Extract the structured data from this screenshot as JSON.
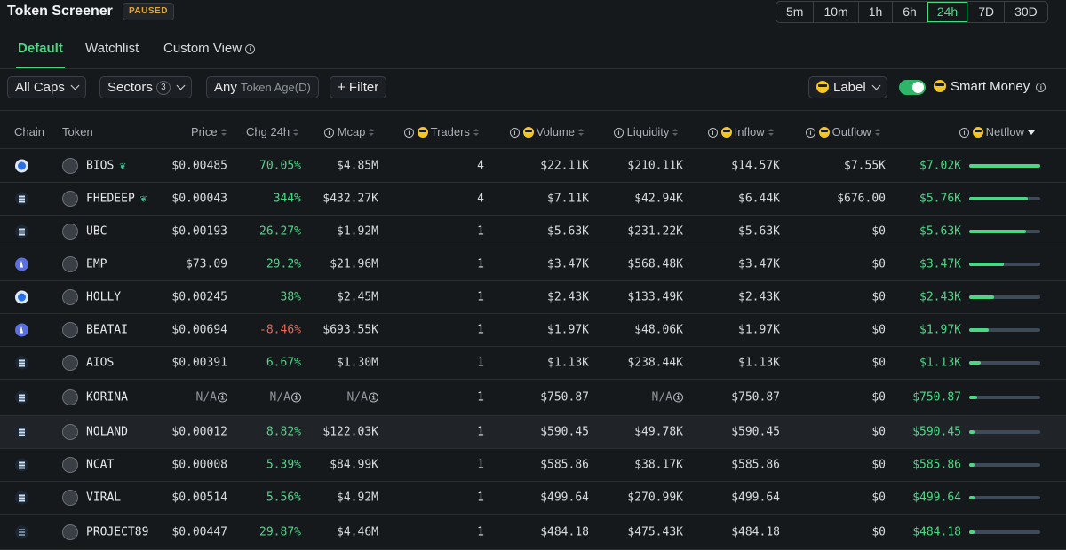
{
  "header": {
    "title": "Token Screener",
    "status": "PAUSED"
  },
  "timeframes": [
    {
      "label": "5m",
      "active": false
    },
    {
      "label": "10m",
      "active": false
    },
    {
      "label": "1h",
      "active": false
    },
    {
      "label": "6h",
      "active": false
    },
    {
      "label": "24h",
      "active": true
    },
    {
      "label": "7D",
      "active": false
    },
    {
      "label": "30D",
      "active": false
    }
  ],
  "tabs": {
    "default": "Default",
    "watchlist": "Watchlist",
    "custom": "Custom View"
  },
  "filters": {
    "caps": "All Caps",
    "sectors": "Sectors",
    "sectors_count": "3",
    "token_age_value": "Any",
    "token_age_label": "Token Age(D)",
    "filter": "+ Filter",
    "label": "Label",
    "smart_money": "Smart Money",
    "smart_money_on": true
  },
  "columns": {
    "chain": "Chain",
    "token": "Token",
    "price": "Price",
    "chg": "Chg 24h",
    "mcap": "Mcap",
    "traders": "Traders",
    "volume": "Volume",
    "liquidity": "Liquidity",
    "inflow": "Inflow",
    "outflow": "Outflow",
    "netflow": "Netflow"
  },
  "rows": [
    {
      "chain": "base",
      "token": "BIOS",
      "leaf": true,
      "price": "$0.00485",
      "chg": "70.05%",
      "chg_dir": "pos",
      "mcap": "$4.85M",
      "traders": "4",
      "volume": "$22.11K",
      "liquidity": "$210.11K",
      "inflow": "$14.57K",
      "outflow": "$7.55K",
      "netflow": "$7.02K",
      "netflow_fraction": 1.0
    },
    {
      "chain": "sol",
      "token": "FHEDEEP",
      "leaf": true,
      "price": "$0.00043",
      "chg": "344%",
      "chg_dir": "pos",
      "mcap": "$432.27K",
      "traders": "4",
      "volume": "$7.11K",
      "liquidity": "$42.94K",
      "inflow": "$6.44K",
      "outflow": "$676.00",
      "netflow": "$5.76K",
      "netflow_fraction": 0.82
    },
    {
      "chain": "sol",
      "token": "UBC",
      "leaf": false,
      "price": "$0.00193",
      "chg": "26.27%",
      "chg_dir": "pos",
      "mcap": "$1.92M",
      "traders": "1",
      "volume": "$5.63K",
      "liquidity": "$231.22K",
      "inflow": "$5.63K",
      "outflow": "$0",
      "netflow": "$5.63K",
      "netflow_fraction": 0.8
    },
    {
      "chain": "eth",
      "token": "EMP",
      "leaf": false,
      "price": "$73.09",
      "chg": "29.2%",
      "chg_dir": "pos",
      "mcap": "$21.96M",
      "traders": "1",
      "volume": "$3.47K",
      "liquidity": "$568.48K",
      "inflow": "$3.47K",
      "outflow": "$0",
      "netflow": "$3.47K",
      "netflow_fraction": 0.49
    },
    {
      "chain": "base",
      "token": "HOLLY",
      "leaf": false,
      "price": "$0.00245",
      "chg": "38%",
      "chg_dir": "pos",
      "mcap": "$2.45M",
      "traders": "1",
      "volume": "$2.43K",
      "liquidity": "$133.49K",
      "inflow": "$2.43K",
      "outflow": "$0",
      "netflow": "$2.43K",
      "netflow_fraction": 0.35
    },
    {
      "chain": "eth",
      "token": "BEATAI",
      "leaf": false,
      "price": "$0.00694",
      "chg": "-8.46%",
      "chg_dir": "neg",
      "mcap": "$693.55K",
      "traders": "1",
      "volume": "$1.97K",
      "liquidity": "$48.06K",
      "inflow": "$1.97K",
      "outflow": "$0",
      "netflow": "$1.97K",
      "netflow_fraction": 0.28
    },
    {
      "chain": "sol",
      "token": "AIOS",
      "leaf": false,
      "price": "$0.00391",
      "chg": "6.67%",
      "chg_dir": "pos",
      "mcap": "$1.30M",
      "traders": "1",
      "volume": "$1.13K",
      "liquidity": "$238.44K",
      "inflow": "$1.13K",
      "outflow": "$0",
      "netflow": "$1.13K",
      "netflow_fraction": 0.16
    },
    {
      "chain": "sol",
      "token": "KORINA",
      "leaf": false,
      "price": "N/A",
      "chg": "N/A",
      "chg_dir": "na",
      "mcap": "N/A",
      "traders": "1",
      "volume": "$750.87",
      "liquidity": "N/A",
      "inflow": "$750.87",
      "outflow": "$0",
      "netflow": "$750.87",
      "netflow_fraction": 0.11
    },
    {
      "chain": "sol",
      "token": "NOLAND",
      "leaf": false,
      "price": "$0.00012",
      "chg": "8.82%",
      "chg_dir": "pos",
      "mcap": "$122.03K",
      "traders": "1",
      "volume": "$590.45",
      "liquidity": "$49.78K",
      "inflow": "$590.45",
      "outflow": "$0",
      "netflow": "$590.45",
      "netflow_fraction": 0.08
    },
    {
      "chain": "sol",
      "token": "NCAT",
      "leaf": false,
      "price": "$0.00008",
      "chg": "5.39%",
      "chg_dir": "pos",
      "mcap": "$84.99K",
      "traders": "1",
      "volume": "$585.86",
      "liquidity": "$38.17K",
      "inflow": "$585.86",
      "outflow": "$0",
      "netflow": "$585.86",
      "netflow_fraction": 0.08
    },
    {
      "chain": "sol",
      "token": "VIRAL",
      "leaf": false,
      "price": "$0.00514",
      "chg": "5.56%",
      "chg_dir": "pos",
      "mcap": "$4.92M",
      "traders": "1",
      "volume": "$499.64",
      "liquidity": "$270.99K",
      "inflow": "$499.64",
      "outflow": "$0",
      "netflow": "$499.64",
      "netflow_fraction": 0.07
    },
    {
      "chain": "sol",
      "token": "PROJECT89",
      "leaf": false,
      "price": "$0.00447",
      "chg": "29.87%",
      "chg_dir": "pos",
      "mcap": "$4.46M",
      "traders": "1",
      "volume": "$484.18",
      "liquidity": "$475.43K",
      "inflow": "$484.18",
      "outflow": "$0",
      "netflow": "$484.18",
      "netflow_fraction": 0.07
    }
  ]
}
